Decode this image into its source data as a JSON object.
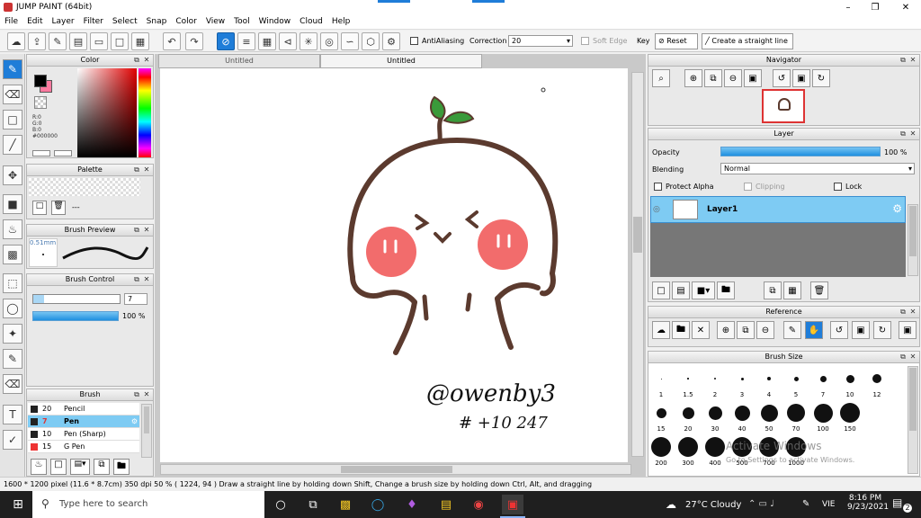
{
  "window": {
    "title": "JUMP PAINT (64bit)"
  },
  "menu": [
    "File",
    "Edit",
    "Layer",
    "Filter",
    "Select",
    "Snap",
    "Color",
    "View",
    "Tool",
    "Window",
    "Cloud",
    "Help"
  ],
  "toolbar": {
    "antialiasing_label": "AntiAliasing",
    "correction_label": "Correction",
    "correction_value": "20",
    "soft_edge_label": "Soft Edge",
    "key_label": "Key",
    "reset_label": "Reset",
    "straight_line_label": "Create a straight line"
  },
  "color_panel": {
    "title": "Color",
    "r": "R:0",
    "g": "G:0",
    "b": "B:0",
    "hex": "#000000",
    "fg": "#000000",
    "bg": "#ff7aa0"
  },
  "palette_panel": {
    "title": "Palette",
    "value": "---"
  },
  "brush_preview": {
    "title": "Brush Preview",
    "size": "0.51mm"
  },
  "brush_control": {
    "title": "Brush Control",
    "size_value": "7",
    "opacity_value": "100 %",
    "opacity": 1.0
  },
  "brush_panel": {
    "title": "Brush",
    "items": [
      {
        "size": "20",
        "name": "Pencil"
      },
      {
        "size": "7",
        "name": "Pen"
      },
      {
        "size": "10",
        "name": "Pen (Sharp)"
      },
      {
        "size": "15",
        "name": "G Pen"
      }
    ]
  },
  "tabs": [
    "Untitled",
    "Untitled"
  ],
  "artwork": {
    "signature": "@owenby3",
    "tag": "# +10 247"
  },
  "navigator": {
    "title": "Navigator"
  },
  "layer_panel": {
    "title": "Layer",
    "opacity_label": "Opacity",
    "opacity_value": "100 %",
    "opacity": 1.0,
    "blending_label": "Blending",
    "blending_value": "Normal",
    "protect_alpha": "Protect Alpha",
    "clipping": "Clipping",
    "lock": "Lock",
    "layer_name": "Layer1"
  },
  "reference_panel": {
    "title": "Reference"
  },
  "brush_size_panel": {
    "title": "Brush Size",
    "row1": [
      "1",
      "1.5",
      "2",
      "3",
      "4",
      "5",
      "7",
      "10",
      "12"
    ],
    "row2": [
      "15",
      "20",
      "30",
      "40",
      "50",
      "70",
      "100",
      "150"
    ],
    "row3": [
      "200",
      "300",
      "400",
      "500",
      "700",
      "1000"
    ],
    "watermark1": "Activate Windows",
    "watermark2": "Go to Settings to activate Windows."
  },
  "status": {
    "text": "1600 * 1200 pixel   (11.6 * 8.7cm)   350 dpi   50 %   ( 1224, 94 )   Draw a straight line by holding down Shift, Change a brush size by holding down Ctrl, Alt, and dragging"
  },
  "taskbar": {
    "search_placeholder": "Type here to search",
    "weather": "27°C  Cloudy",
    "lang": "VIE",
    "time": "8:16 PM",
    "date": "9/23/2021",
    "notif": "2"
  },
  "colors": {
    "accent": "#1f7dd8",
    "layer_sel": "#7ecbf3",
    "blush": "#f26c6c",
    "line": "#5b3a2e",
    "leaf": "#3a9a3a"
  }
}
